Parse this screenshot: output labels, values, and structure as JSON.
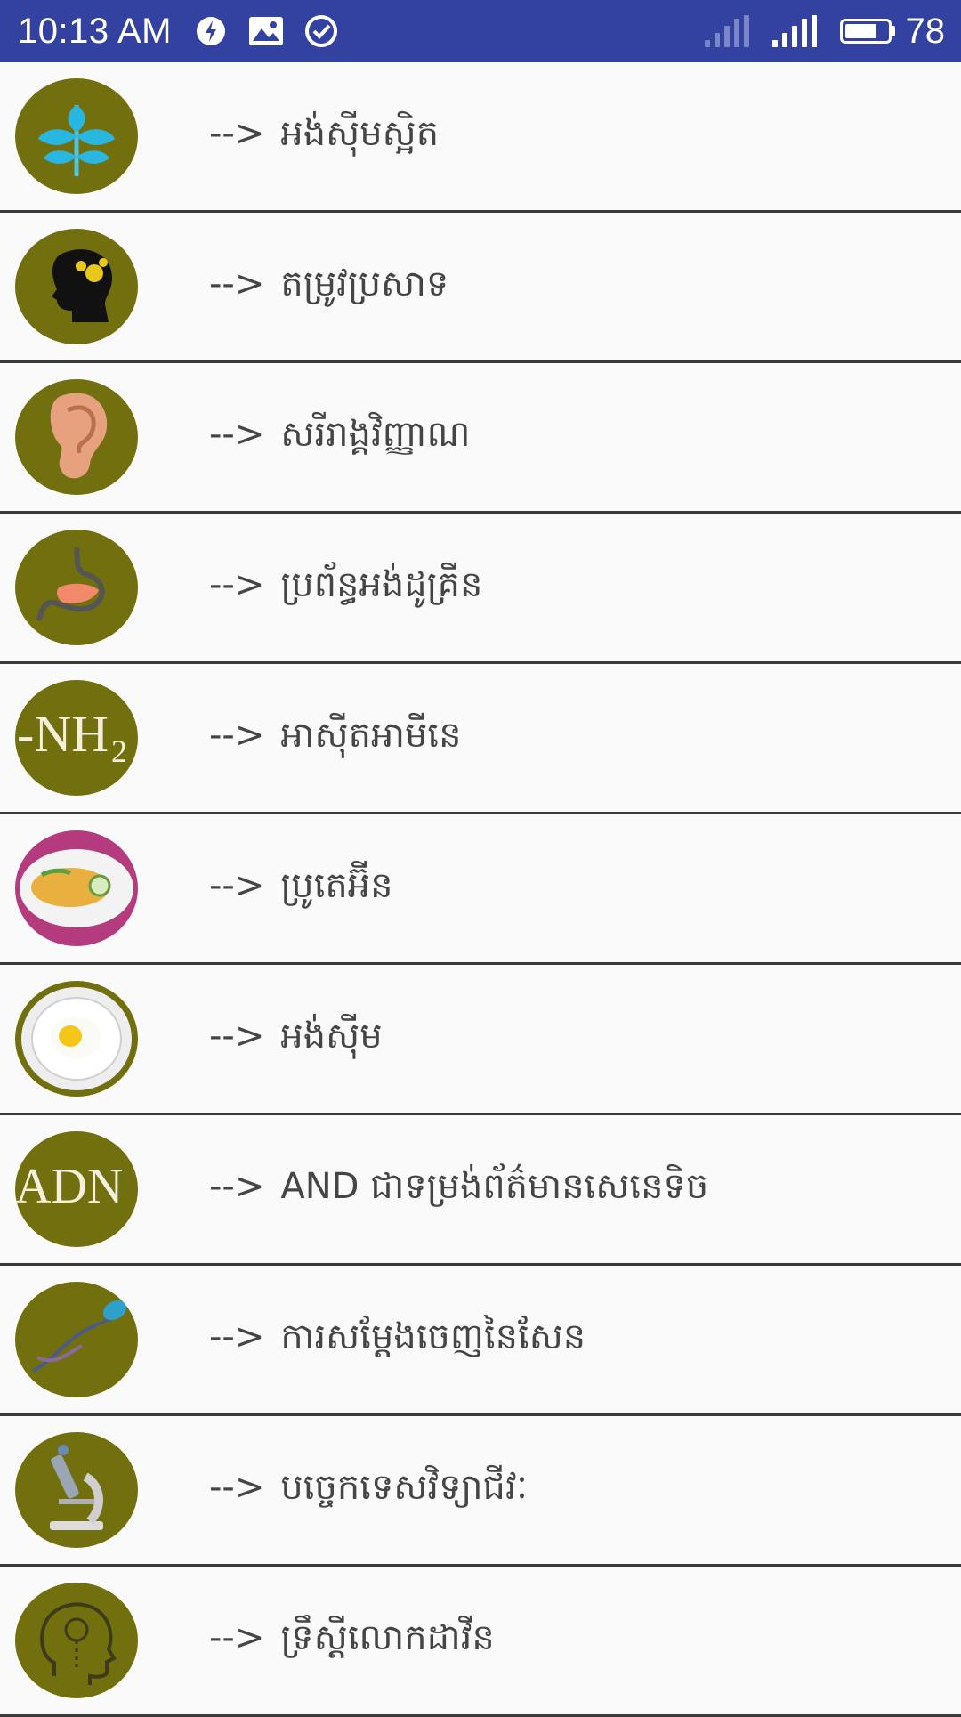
{
  "status_bar": {
    "time": "10:13 AM",
    "battery_level": "78"
  },
  "list": {
    "items": [
      {
        "arrow": "-->",
        "label": "អង់ស៊ីមស្អិត",
        "icon": "plant-icon"
      },
      {
        "arrow": "-->",
        "label": "តម្រូវប្រសាទ",
        "icon": "head-gears-icon"
      },
      {
        "arrow": "-->",
        "label": "សរីរាង្គវិញ្ញាណ",
        "icon": "ear-icon"
      },
      {
        "arrow": "-->",
        "label": "ប្រព័ន្ធអង់ដូគ្រីន",
        "icon": "stomach-icon"
      },
      {
        "arrow": "-->",
        "label": "អាស៊ីតអាមីនេ",
        "icon": "nh2-icon"
      },
      {
        "arrow": "-->",
        "label": "ប្រូតេអ៊ីន",
        "icon": "food-plate-icon"
      },
      {
        "arrow": "-->",
        "label": "អង់ស៊ីម",
        "icon": "fried-egg-icon"
      },
      {
        "arrow": "-->",
        "label": "AND ជាទម្រង់ព័ត៌មានសេនេទិច",
        "icon": "adn-icon"
      },
      {
        "arrow": "-->",
        "label": "ការសម្តែងចេញនៃសែន",
        "icon": "dna-sperm-icon"
      },
      {
        "arrow": "-->",
        "label": "បច្ចេកទេសវិទ្យាជីវៈ",
        "icon": "microscope-icon"
      },
      {
        "arrow": "-->",
        "label": "ទ្រឹស្តីលោកដាវីន",
        "icon": "head-bulb-icon"
      }
    ]
  },
  "colors": {
    "status_bar": "#3342a0",
    "avatar_bg": "#726f0e",
    "divider": "#3a3a3a",
    "text": "#454545"
  }
}
